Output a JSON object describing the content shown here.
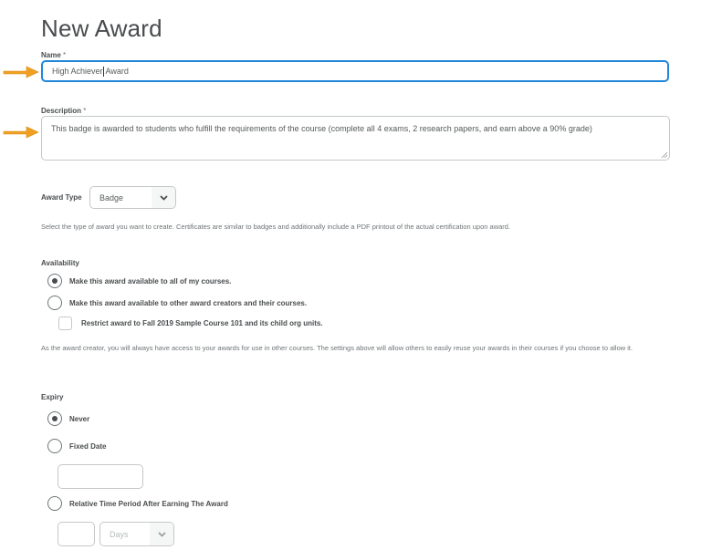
{
  "page": {
    "title": "New Award"
  },
  "name_field": {
    "label": "Name",
    "required_mark": "*",
    "value_before_caret": "High Achiever",
    "value_after_caret": " Award"
  },
  "description_field": {
    "label": "Description",
    "required_mark": "*",
    "value": "This badge is awarded to students who fulfill the requirements of the course (complete all 4 exams, 2 research papers, and earn above a 90% grade)"
  },
  "award_type": {
    "label": "Award Type",
    "selected": "Badge",
    "help_text": "Select the type of award you want to create. Certificates are similar to badges and additionally include a PDF printout of the actual certification upon award."
  },
  "availability": {
    "label": "Availability",
    "options": [
      {
        "label": "Make this award available to all of my courses.",
        "selected": true
      },
      {
        "label": "Make this award available to other award creators and their courses.",
        "selected": false
      }
    ],
    "restrict_checkbox": {
      "label": "Restrict award to Fall 2019 Sample Course 101 and its child org units.",
      "checked": false
    },
    "help_text": "As the award creator, you will always have access to your awards for use in other courses. The settings above will allow others to easily reuse your awards in their courses if you choose to allow it."
  },
  "expiry": {
    "label": "Expiry",
    "options": [
      {
        "label": "Never",
        "selected": true
      },
      {
        "label": "Fixed Date",
        "selected": false
      },
      {
        "label": "Relative Time Period After Earning The Award",
        "selected": false
      }
    ],
    "fixed_date_value": "",
    "relative_amount_value": "",
    "relative_unit_selected": "Days"
  },
  "annotations": {
    "arrow_color": "#f0a020"
  },
  "colors": {
    "focus_border": "#2186d8",
    "text": "#494c4e",
    "muted_text": "#6e7477",
    "border": "#c4c7c8"
  }
}
